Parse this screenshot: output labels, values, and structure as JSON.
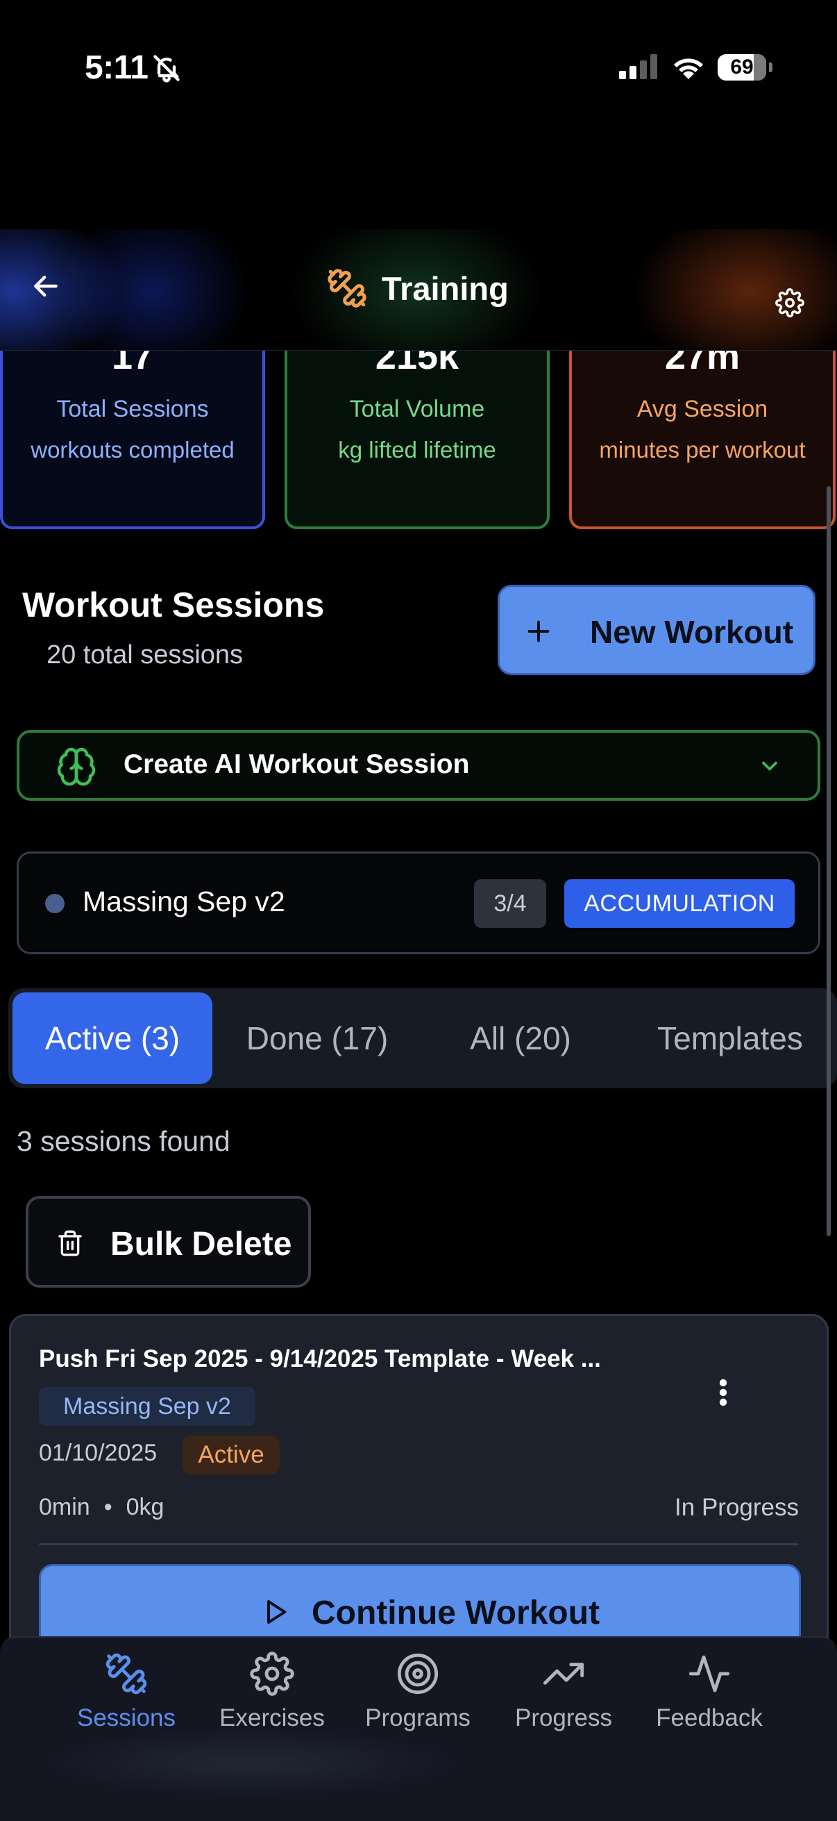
{
  "status_bar": {
    "time": "5:11",
    "battery": "69"
  },
  "header": {
    "title": "Training"
  },
  "stats": [
    {
      "value": "17",
      "label": "Total Sessions",
      "sub": "workouts completed"
    },
    {
      "value": "215k",
      "label": "Total Volume",
      "sub": "kg lifted lifetime"
    },
    {
      "value": "27m",
      "label": "Avg Session",
      "sub": "minutes per workout"
    }
  ],
  "sessions": {
    "title": "Workout Sessions",
    "count": "20 total sessions",
    "new_workout_label": "New Workout"
  },
  "ai_session": {
    "label": "Create AI Workout Session"
  },
  "program": {
    "name": "Massing Sep v2",
    "week": "3/4",
    "phase": "ACCUMULATION"
  },
  "tabs": [
    {
      "label": "Active (3)",
      "active": true
    },
    {
      "label": "Done (17)",
      "active": false
    },
    {
      "label": "All (20)",
      "active": false
    },
    {
      "label": "Templates",
      "active": false
    }
  ],
  "found_text": "3 sessions found",
  "bulk_delete_label": "Bulk Delete",
  "session_card": {
    "title": "Push Fri Sep 2025 - 9/14/2025 Template - Week ...",
    "program_tag": "Massing Sep v2",
    "date": "01/10/2025",
    "status": "Active",
    "duration": "0min",
    "dot": "•",
    "volume": "0kg",
    "progress": "In Progress",
    "continue_label": "Continue Workout"
  },
  "bottom_nav": [
    {
      "label": "Sessions",
      "icon": "dumbbell-icon",
      "active": true
    },
    {
      "label": "Exercises",
      "icon": "gear-icon",
      "active": false
    },
    {
      "label": "Programs",
      "icon": "target-icon",
      "active": false
    },
    {
      "label": "Progress",
      "icon": "trending-up-icon",
      "active": false
    },
    {
      "label": "Feedback",
      "icon": "activity-icon",
      "active": false
    }
  ],
  "colors": {
    "accent": "#5b8fec",
    "tab_active": "#3466ea",
    "sessions_card": "#3a52d8",
    "volume_card": "#2e7d3e",
    "avg_card": "#c8542a",
    "status_active": "#f5a562",
    "brand_orange": "#f0a050"
  }
}
